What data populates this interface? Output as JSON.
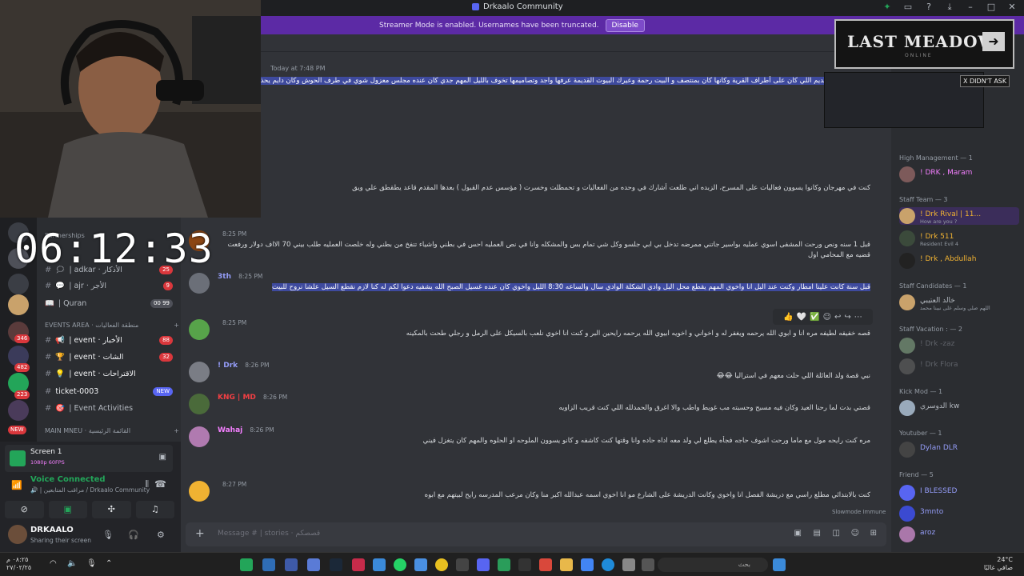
{
  "window": {
    "title": "Drkaalo Community"
  },
  "banner": {
    "text": "Streamer Mode is enabled. Usernames have been truncated.",
    "button": "Disable"
  },
  "clock": "06:12:33",
  "overlay": {
    "game_title": "LAST MEADOW",
    "subtitle": "ONLINE",
    "tag": "X DIDN'T ASK"
  },
  "rail_badges": [
    "346",
    "482",
    "223",
    "NEW"
  ],
  "sidebar": {
    "top_categories": [
      "Partnerships"
    ],
    "channels_top": [
      {
        "emoji": "🗯",
        "label": "| adkar · الأذكار",
        "badge": "25"
      },
      {
        "emoji": "💬",
        "label": "| ajr · الأجر",
        "badge": "9"
      },
      {
        "emoji": "📖",
        "label": "| Quran",
        "badge": "00 99"
      }
    ],
    "events_category": "EVENTS AREA · منطقة الفعاليات",
    "channels_events": [
      {
        "emoji": "📢",
        "label": "| event · الأخبار",
        "badge": "88"
      },
      {
        "emoji": "🏆",
        "label": "| event · الشات",
        "badge": "32"
      },
      {
        "emoji": "💡",
        "label": "| event · الاقتراحات",
        "badge": ""
      },
      {
        "emoji": "#",
        "label": "ticket-0003",
        "badge": "NEW"
      },
      {
        "emoji": "🎯",
        "label": "| Event Activities",
        "badge": ""
      }
    ],
    "menu_category": "MAIN MNEU · القائمة الرئيسية"
  },
  "panel": {
    "screen_title": "Screen 1",
    "screen_sub": "1080p 60FPS",
    "voice_title": "Voice Connected",
    "voice_sub": "🔊 | مراقب المتابعين / Drkaalo Community",
    "user_name": "DRKAALO",
    "user_status": "Sharing their screen"
  },
  "chat": {
    "header_time": "Today at 7:48 PM",
    "messages": [
      {
        "name": "",
        "time": "",
        "color": "#dbdee1",
        "text": "فير بيت جدي القديم اللي كان على أطراف القرية وكانها كان بمنتصف و البيت رحمة وعيرك البيوت القديمة عرفها واجد وتصاميمها تخوف بالليل المهم جدي كان عنده مجلس معزول شوي في طرف الحوش وكان دايم يحذر نا نحطه نتك",
        "hl": true
      },
      {
        "name": "",
        "time": "",
        "color": "#dbdee1",
        "text": "كنت في مهرجان وكانوا يسوون فعاليات على المسرح، الزبده اني طلعت أشارك في وحده من الفعاليات و تحمطلت وخسرت ( مؤسس عدم القبول ) بعدها المقدم قاعد يطقطق علي ويق",
        "hl": false
      },
      {
        "name": "",
        "time": "8:25 PM",
        "color": "#f47fff",
        "text": "قبل 1 سنه ونص ورحت المشفى اسوي عمليه بواسير جاتني ممرضه تدخل بي ابي جلسو وكل شي تمام بس والمشكله وانا في نص العمليه احس في بطني واشياء تتفخ من بطني وله خلصت العمليه طلب بيني 70 الااف دولار ورفعت قضيه مع المحامي اول",
        "hl": false
      },
      {
        "name": "3th",
        "time": "8:25 PM",
        "color": "#949cf7",
        "text": "قبل سنة كانت علينا امطار وكنت عند البل انا واخوي المهم يقطع محل البل وادي الشكلة الوادي سال والساعه 8:30 الليل واخوي كان عنده غسيل الصبح الله يشفيه دعوا لكم له كنا لازم نقطع السيل علشا نروح للبيت",
        "hl": true
      },
      {
        "name": "",
        "time": "8:25 PM",
        "color": "#f23f43",
        "text": "قصه خفيفه لطيفه مره انا و ابوي الله يرحمه ويغفر له و اخواني و اخويه ابيوي الله يرحمه رايحين البر و كنت انا اخوي نلعب بالسيكل على الرمل و رجلي طحت بالمكينه",
        "hl": false
      },
      {
        "name": "! Drk",
        "time": "8:26 PM",
        "color": "#949cf7",
        "text": "نبي قصة ولد العائلة اللي حلت معهم في استراليا 😂😂",
        "hl": false
      },
      {
        "name": "KNG | MD",
        "time": "8:26 PM",
        "color": "#f23f43",
        "text": "قصتي بدت لما رحنا العيد وكان فيه مسبح وحسبته مب غويط واطب والا اغرق والحمدلله اللي كنت قريب الزاويه",
        "hl": false
      },
      {
        "name": "Wahaj",
        "time": "8:26 PM",
        "color": "#f47fff",
        "text": "مره كنت رايحه مول مع ماما ورحت اشوف حاجه فجأه يطلع لي ولد معه اداه حاده وانا وقتها كنت كاشفه و كانو يسوون الملوحه او الحلوه والمهم كان يتغزل فيني",
        "hl": false
      },
      {
        "name": "",
        "time": "8:27 PM",
        "color": "#f23f43",
        "text": "كنت بالابتدائي مطلع راسي مع دريشة الفصل انا واخوي وكانت الدريشة على الشارع مو انا اخوي اسمه عبدالله اكبر منا وكان مرعب المدرسه رايح لبيتهم مع ابوه",
        "hl": false
      }
    ],
    "composer_placeholder": "Message # | stories · قصصكم",
    "slowmode": "Slowmode Immune"
  },
  "members": {
    "groups": [
      {
        "label": "High Management — 1",
        "members": [
          {
            "name": "! DRK , Maram",
            "sub": "",
            "color": "#f47fff"
          }
        ]
      },
      {
        "label": "Staff Team — 3",
        "members": [
          {
            "name": "! Drk Rival | 11...",
            "sub": "How are you ?",
            "color": "#f0b232"
          },
          {
            "name": "! Drk 511",
            "sub": "Resident Evil 4",
            "color": "#f0b232"
          },
          {
            "name": "! Drk , Abdullah",
            "sub": "",
            "color": "#f0b232"
          }
        ]
      },
      {
        "label": "Staff Candidates — 1",
        "members": [
          {
            "name": "خالد العتيبي",
            "sub": "اللهم صلي وسلم على نبينا محمد",
            "color": "#b5bac1"
          }
        ]
      },
      {
        "label": "Staff Vacation : — 2",
        "members": [
          {
            "name": "! Drk -zaz",
            "sub": "",
            "color": "#80848e"
          },
          {
            "name": "! Drk Flora",
            "sub": "",
            "color": "#80848e"
          }
        ]
      },
      {
        "label": "Kick Mod — 1",
        "members": [
          {
            "name": "الدوسري kw",
            "sub": "",
            "color": "#b5bac1"
          }
        ]
      },
      {
        "label": "Youtuber — 1",
        "members": [
          {
            "name": "Dylan DLR",
            "sub": "",
            "color": "#949cf7"
          }
        ]
      },
      {
        "label": "Friend — 5",
        "members": [
          {
            "name": "I BLESSED",
            "sub": "",
            "color": "#949cf7"
          },
          {
            "name": "3mnto",
            "sub": "",
            "color": "#949cf7"
          },
          {
            "name": "aroz",
            "sub": "",
            "color": "#949cf7"
          }
        ]
      }
    ]
  },
  "taskbar": {
    "left_top": "٠٨:٢٥ م",
    "left_bottom": "٢٧/٠٢/٢٥",
    "search": "بحث",
    "weather_temp": "24°C",
    "weather_desc": "صافي غالبًا"
  }
}
